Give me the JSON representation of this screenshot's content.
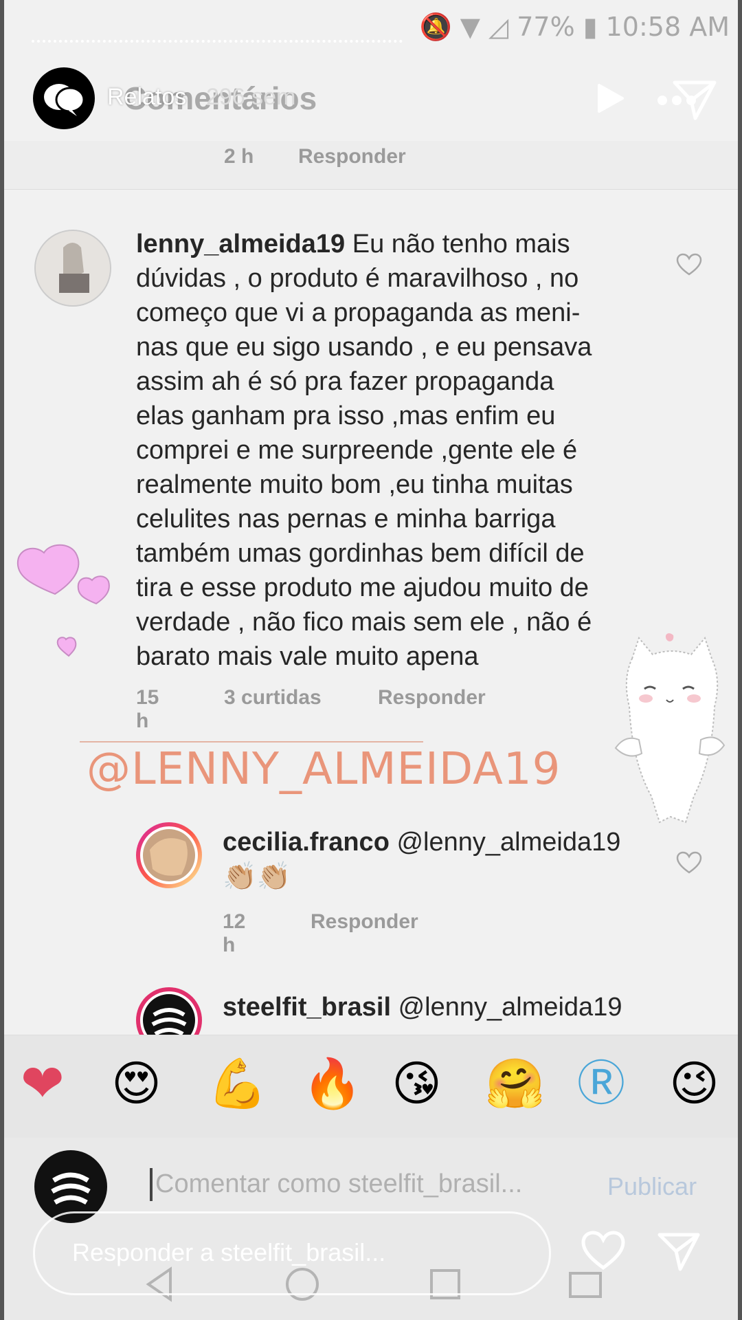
{
  "status_bar": {
    "battery": "77%",
    "time": "10:58 AM"
  },
  "story": {
    "username": "Relatos",
    "time": "296 sem",
    "ghost_title": "Comentários"
  },
  "prev_comment": {
    "time": "2 h",
    "reply": "Responder"
  },
  "comments": [
    {
      "username": "lenny_almeida19",
      "lines": [
        "Eu não tenho mais",
        "dúvidas , o produto é maravilhoso , no",
        "começo que vi a propaganda as meni-",
        "nas que eu sigo usando ,  e eu pensava",
        "assim ah é só pra fazer propaganda",
        "elas ganham pra isso ,mas enfim eu",
        "comprei e me surpreende ,gente ele é",
        "realmente muito bom ,eu tinha muitas",
        "celulites nas pernas  e minha barriga",
        "também umas gordinhas bem difícil de",
        "tira e esse produto me ajudou muito de",
        "verdade , não fico mais sem ele , não é",
        "barato mais vale muito apena"
      ],
      "time": "15 h",
      "likes": "3 curtidas",
      "reply": "Responder"
    },
    {
      "username": "cecilia.franco",
      "text": "@lenny_almeida19",
      "emoji": "👏🏼👏🏼",
      "time": "12 h",
      "reply": "Responder"
    },
    {
      "username": "steelfit_brasil",
      "text": "@lenny_almeida19"
    }
  ],
  "mention_sticker": "@LENNY_ALMEIDA19",
  "emoji_bar": [
    "❤",
    "😍",
    "💪",
    "🔥",
    "😘",
    "🤗",
    "Ⓡ",
    "😉"
  ],
  "comment_input": {
    "placeholder": "Comentar como steelfit_brasil...",
    "publish": "Publicar"
  },
  "reply_input": {
    "placeholder": "Responder a steelfit_brasil..."
  },
  "colors": {
    "accent": "#e9957a",
    "heart_pink": "#f5b2f0",
    "text": "#262626",
    "meta": "#9a9a9a"
  }
}
